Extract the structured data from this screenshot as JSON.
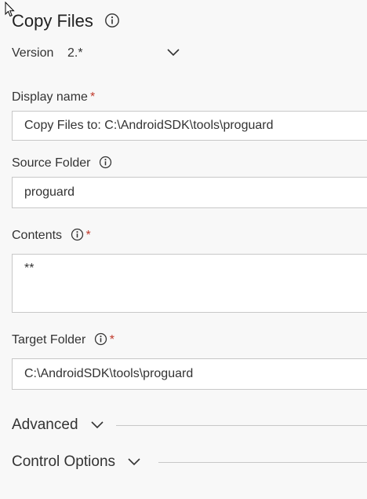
{
  "task": {
    "title": "Copy Files",
    "version_label": "Version",
    "version_value": "2.*"
  },
  "fields": {
    "display_name": {
      "label": "Display name",
      "required_mark": "*",
      "value": "Copy Files to: C:\\AndroidSDK\\tools\\proguard"
    },
    "source_folder": {
      "label": "Source Folder",
      "value": "proguard"
    },
    "contents": {
      "label": "Contents",
      "required_mark": "*",
      "value": "**"
    },
    "target_folder": {
      "label": "Target Folder",
      "required_mark": "*",
      "value": "C:\\AndroidSDK\\tools\\proguard"
    }
  },
  "sections": {
    "advanced": "Advanced",
    "control_options": "Control Options"
  },
  "colors": {
    "background": "#f8f8f8",
    "required": "#c0392b",
    "input_border": "#c8c8c8"
  },
  "icons": [
    "info-icon",
    "chevron-down-icon",
    "mouse-cursor-icon"
  ]
}
